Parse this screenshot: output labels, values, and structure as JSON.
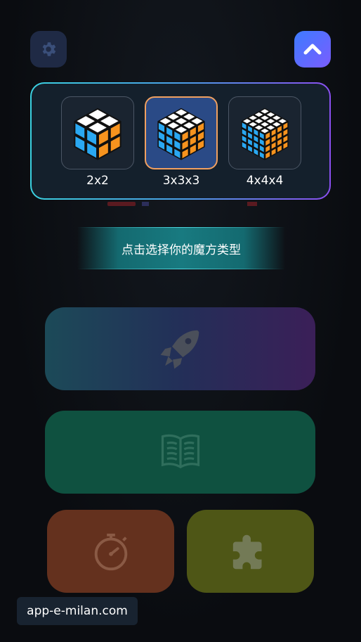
{
  "top_bar": {
    "settings_icon": "gear-icon",
    "up_icon": "chevron-up-icon"
  },
  "cube_selector": {
    "items": [
      {
        "label": "2x2",
        "size": 2,
        "selected": false
      },
      {
        "label": "3x3x3",
        "size": 3,
        "selected": true
      },
      {
        "label": "4x4x4",
        "size": 4,
        "selected": false
      }
    ]
  },
  "hint": {
    "text": "点击选择你的魔方类型"
  },
  "menu": {
    "play_icon": "rocket-icon",
    "learn_icon": "book-icon",
    "timer_icon": "stopwatch-icon",
    "puzzle_icon": "puzzle-piece-icon"
  },
  "watermark": {
    "text": "app-e-milan.com"
  },
  "colors": {
    "cube_orange": "#f7931e",
    "cube_blue": "#2aa8f2",
    "cube_white": "#ffffff",
    "selected_border": "#f0a060"
  }
}
